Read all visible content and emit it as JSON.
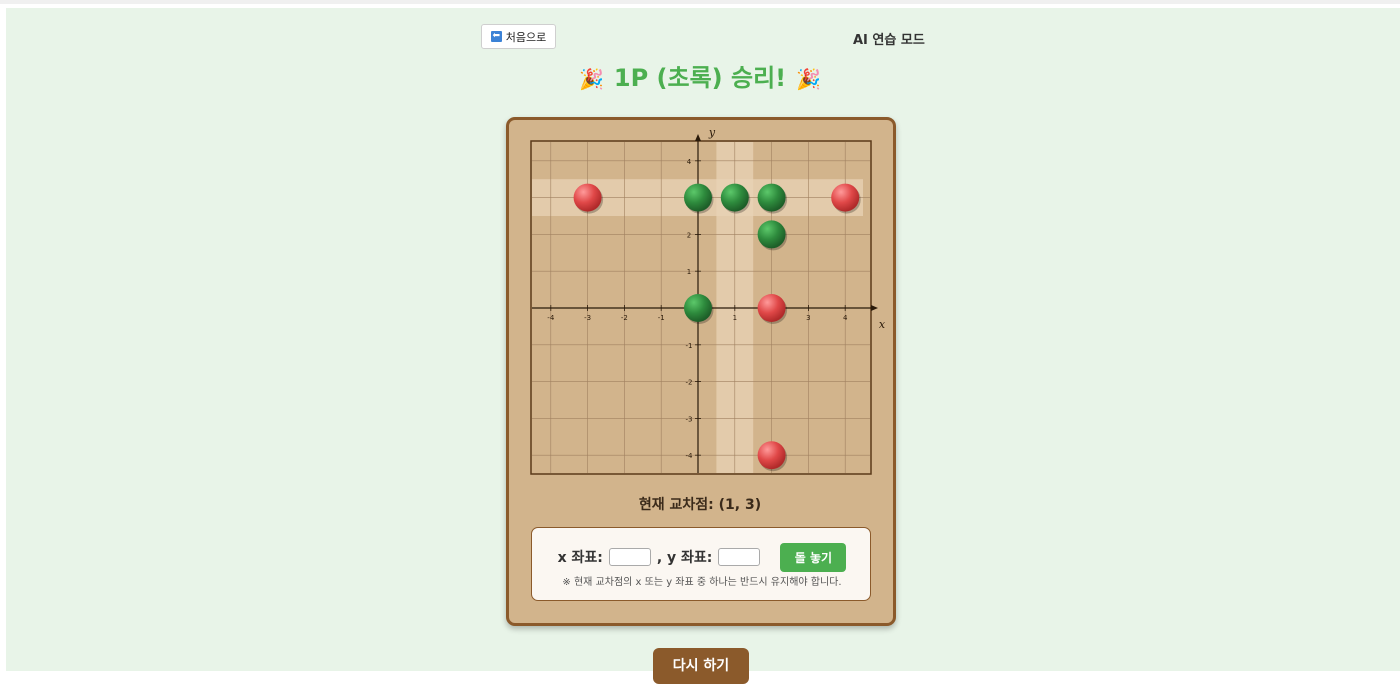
{
  "header": {
    "back_button_label": "처음으로",
    "back_icon": "left-arrow-icon",
    "mode_label": "AI 연습 모드"
  },
  "result": {
    "party_icon": "🎉",
    "title": "1P (초록) 승리!"
  },
  "board": {
    "x_axis_label": "x",
    "y_axis_label": "y",
    "x_range": [
      -4.5,
      4.5
    ],
    "y_range": [
      -4.5,
      4.5
    ],
    "tick_values": [
      -4,
      -3,
      -2,
      -1,
      1,
      2,
      3,
      4
    ],
    "highlight": {
      "x": 1,
      "y": 3
    },
    "colors": {
      "board": "#d2b48c",
      "grid": "#a08060",
      "highlight": "#e8d3b6",
      "green_stone": "#2e8b3d",
      "red_stone": "#e04848"
    },
    "stones": [
      {
        "x": -3,
        "y": 3,
        "color": "red"
      },
      {
        "x": 0,
        "y": 3,
        "color": "green"
      },
      {
        "x": 1,
        "y": 3,
        "color": "green"
      },
      {
        "x": 2,
        "y": 3,
        "color": "green"
      },
      {
        "x": 4,
        "y": 3,
        "color": "red"
      },
      {
        "x": 2,
        "y": 2,
        "color": "green"
      },
      {
        "x": 0,
        "y": 0,
        "color": "green"
      },
      {
        "x": 2,
        "y": 0,
        "color": "red"
      },
      {
        "x": 2,
        "y": -4,
        "color": "red"
      }
    ]
  },
  "status": {
    "intersection_text": "현재 교차점: (1, 3)"
  },
  "input": {
    "x_label": "x 좌표:",
    "y_label": ", y 좌표:",
    "x_value": "",
    "y_value": "",
    "place_button_label": "돌 놓기",
    "rule_note": "※ 현재 교차점의 x 또는 y 좌표 중 하나는 반드시 유지해야 합니다."
  },
  "footer": {
    "restart_button_label": "다시 하기"
  }
}
